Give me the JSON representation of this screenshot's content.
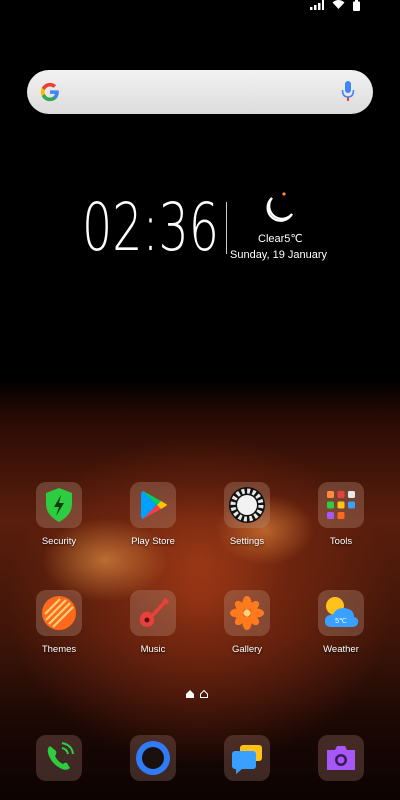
{
  "status_bar": {
    "icons": [
      "signal-icon",
      "wifi-icon",
      "battery-icon"
    ]
  },
  "search": {
    "logo": "google-logo",
    "mic_icon": "mic-icon"
  },
  "clock_widget": {
    "time": "02:36",
    "weather_icon": "moon-icon",
    "weather": "Clear5℃",
    "date": "Sunday, 19 January"
  },
  "apps_row1": [
    {
      "label": "Security",
      "icon": "shield-icon"
    },
    {
      "label": "Play Store",
      "icon": "play-store-icon"
    },
    {
      "label": "Settings",
      "icon": "gear-icon"
    },
    {
      "label": "Tools",
      "icon": "tools-folder-icon"
    }
  ],
  "apps_row2": [
    {
      "label": "Themes",
      "icon": "themes-icon"
    },
    {
      "label": "Music",
      "icon": "guitar-icon"
    },
    {
      "label": "Gallery",
      "icon": "flower-icon"
    },
    {
      "label": "Weather",
      "icon": "weather-icon",
      "badge": "5℃"
    }
  ],
  "page_indicator": {
    "icons": [
      "page-dot-icon",
      "home-page-icon"
    ]
  },
  "dock": [
    {
      "icon": "phone-icon"
    },
    {
      "icon": "browser-icon"
    },
    {
      "icon": "messages-icon"
    },
    {
      "icon": "camera-icon"
    }
  ],
  "colors": {
    "security": "#2ecc40",
    "themes": "#ff6a1a",
    "music": "#e8403a",
    "gallery": "#ff7a1c",
    "weather": "#3aa0ff",
    "phone": "#2ecc40",
    "browser": "#2f7cf6",
    "messages_blue": "#3aa0ff",
    "messages_yellow": "#ffc21a",
    "camera": "#a657f5"
  }
}
